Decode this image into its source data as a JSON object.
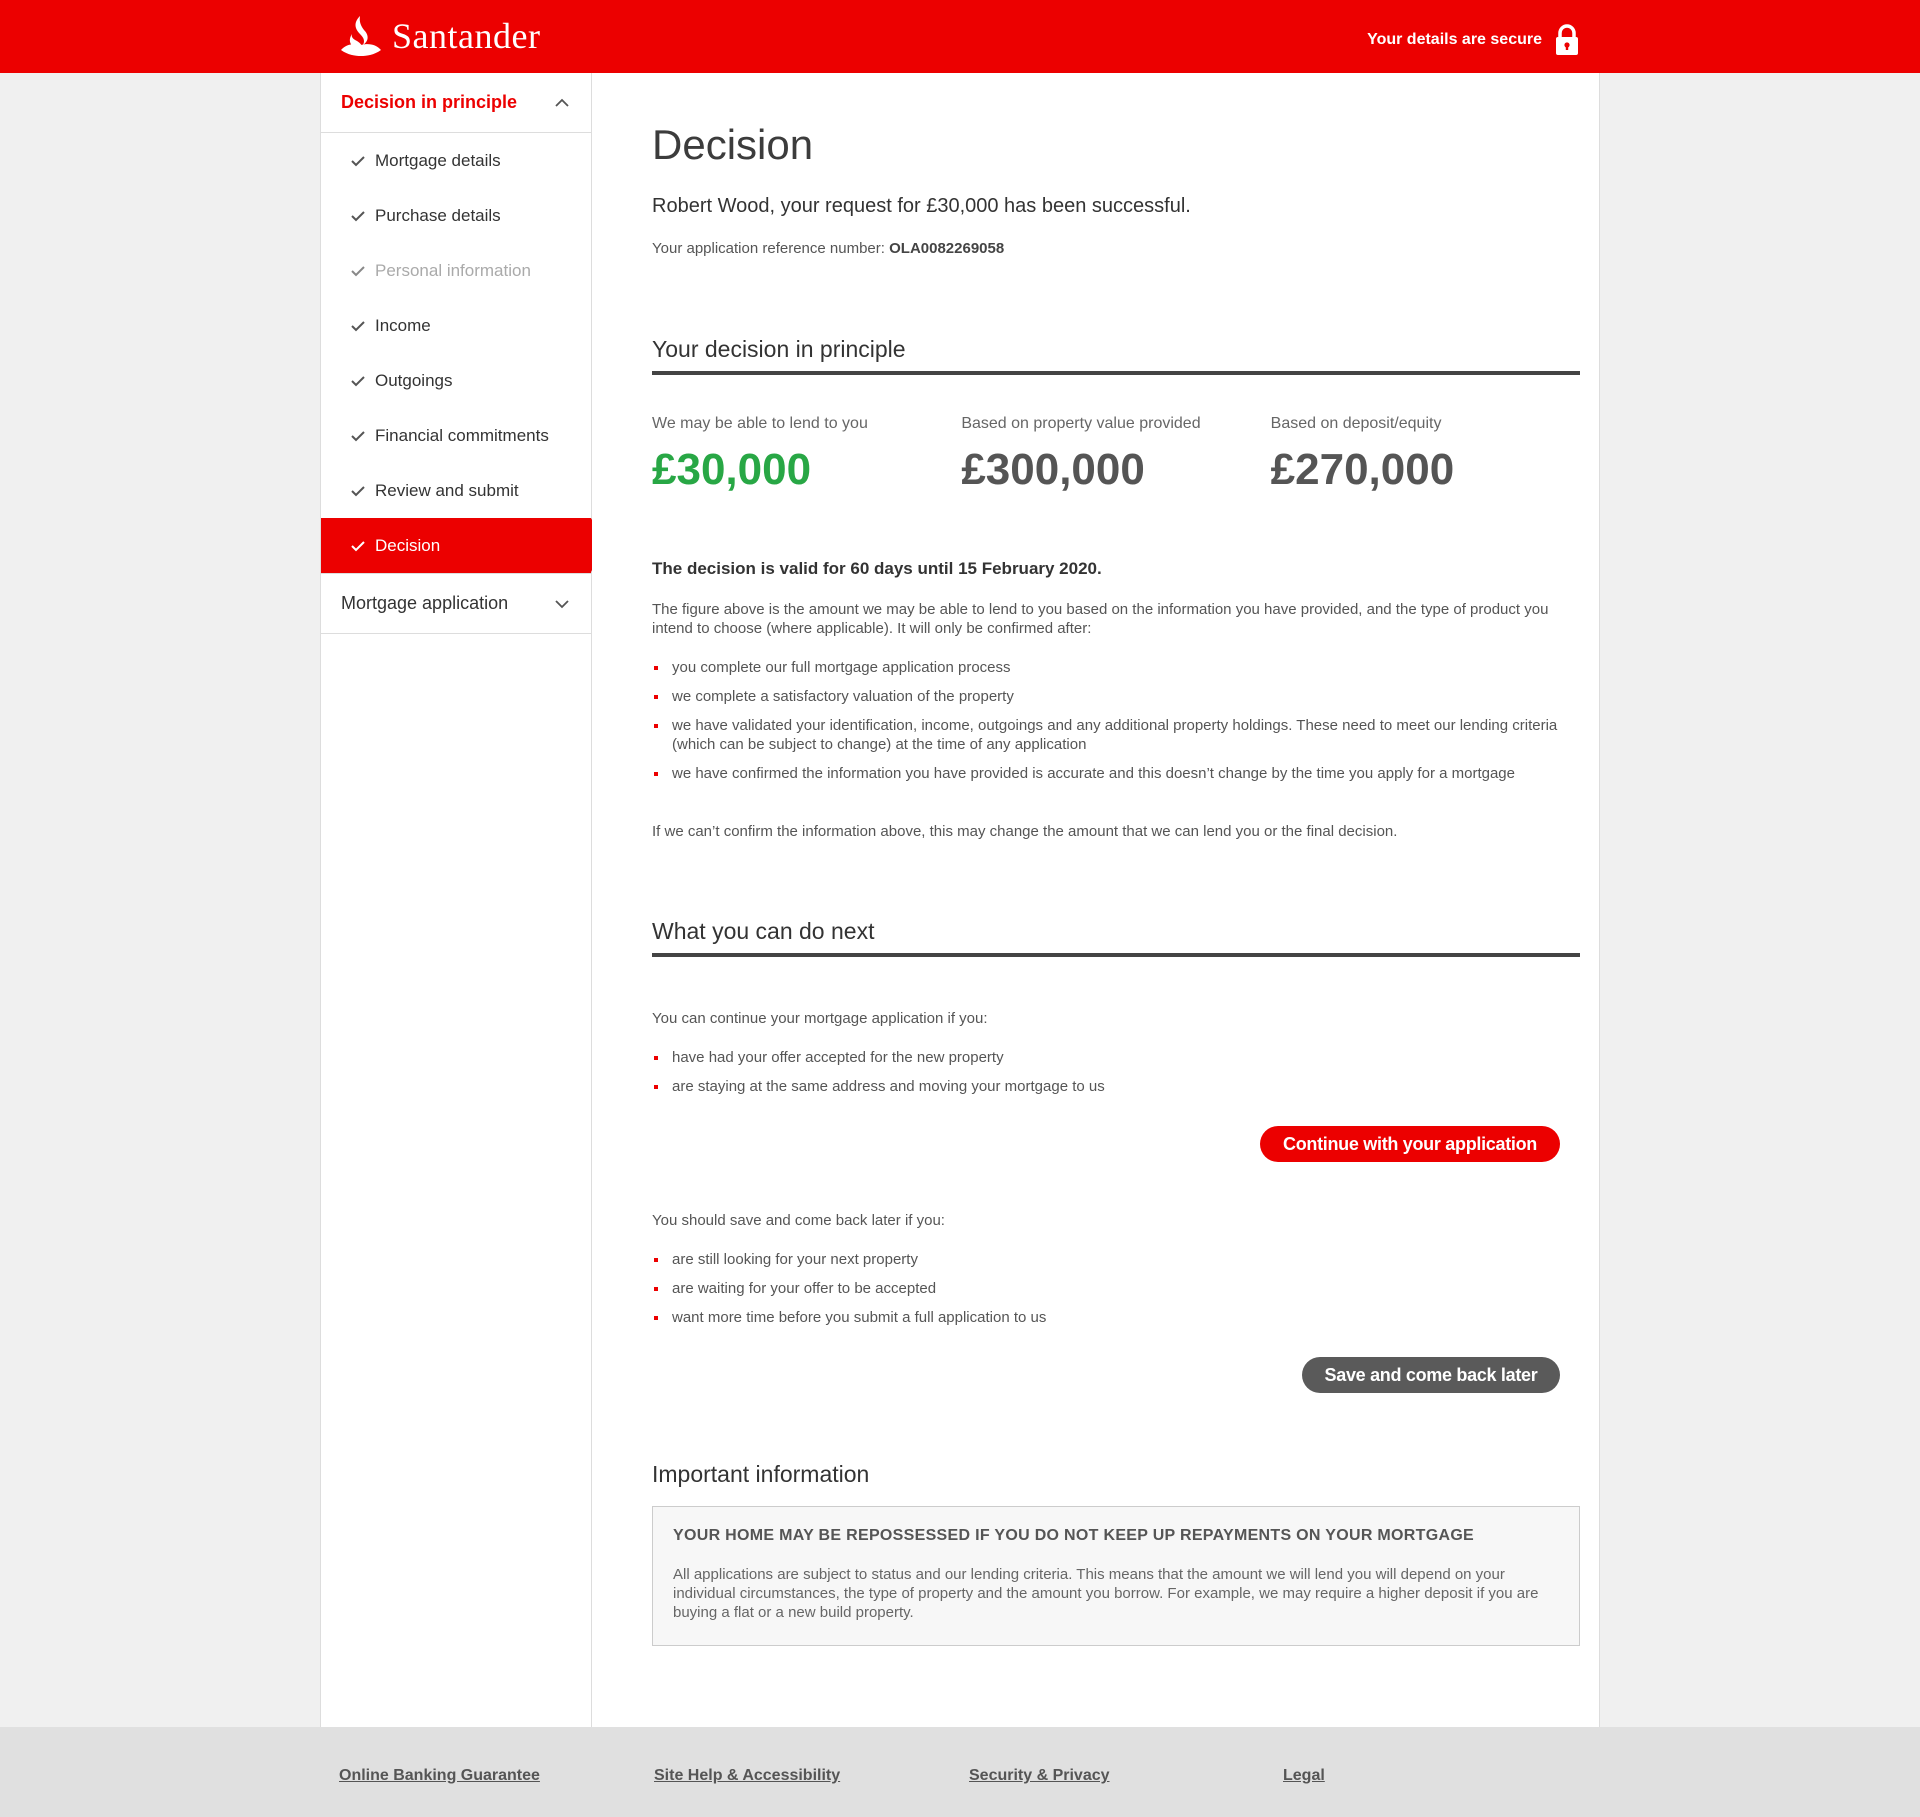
{
  "header": {
    "brand": "Santander",
    "secure_text": "Your details are secure"
  },
  "sidebar": {
    "section_title": "Decision in principle",
    "items": [
      {
        "label": "Mortgage details",
        "state": "done"
      },
      {
        "label": "Purchase details",
        "state": "done"
      },
      {
        "label": "Personal information",
        "state": "disabled"
      },
      {
        "label": "Income",
        "state": "done"
      },
      {
        "label": "Outgoings",
        "state": "done"
      },
      {
        "label": "Financial commitments",
        "state": "done"
      },
      {
        "label": "Review and submit",
        "state": "done"
      },
      {
        "label": "Decision",
        "state": "active"
      }
    ],
    "next_section": "Mortgage application"
  },
  "main": {
    "title": "Decision",
    "greeting": "Robert Wood, your request for £30,000 has been successful.",
    "ref_label": "Your application reference number:",
    "ref_number": "OLA0082269058",
    "dip_title": "Your decision in principle",
    "figures": [
      {
        "label": "We may be able to lend to you",
        "value": "£30,000",
        "color": "#28a745"
      },
      {
        "label": "Based on property value provided",
        "value": "£300,000"
      },
      {
        "label": "Based on deposit/equity",
        "value": "£270,000"
      }
    ],
    "valid_text": "The decision is valid for 60 days until 15 February 2020.",
    "figure_note": "The figure above is the amount we may be able to lend to you based on the information you have provided, and the type of product you intend to choose (where applicable). It will only be confirmed after:",
    "conditions": [
      "you complete our full mortgage application process",
      "we complete a satisfactory valuation of the property",
      "we have validated your identification, income, outgoings and any additional property holdings. These need to meet our lending criteria (which can be subject to change) at the time of any application",
      "we have confirmed the information you have provided is accurate and this doesn’t change by the time you apply for a mortgage"
    ],
    "cant_confirm": "If we can’t confirm the information above, this may change the amount that we can lend you or the final decision.",
    "next_title": "What you can do next",
    "continue_intro": "You can continue your mortgage application if you:",
    "continue_reasons": [
      "have had your offer accepted for the new property",
      "are staying at the same address and moving your mortgage to us"
    ],
    "continue_button": "Continue with your application",
    "save_intro": "You should save and come back later if you:",
    "save_reasons": [
      "are still looking for your next property",
      "are waiting for your offer to be accepted",
      "want more time before you submit a full application to us"
    ],
    "save_button": "Save and come back later",
    "important_title": "Important information",
    "warning_head": "YOUR HOME MAY BE REPOSSESSED IF YOU DO NOT KEEP UP REPAYMENTS ON YOUR MORTGAGE",
    "warning_text": "All applications are subject to status and our lending criteria. This means that the amount we will lend you will depend on your individual circumstances, the type of property and the amount you borrow. For example, we may require a higher deposit if you are buying a flat or a new build property."
  },
  "footer": {
    "links": [
      "Online Banking Guarantee",
      "Site Help & Accessibility",
      "Security & Privacy",
      "Legal"
    ]
  },
  "colors": {
    "brand_red": "#ec0000",
    "success_green": "#28a745"
  },
  "icons": [
    "santander-flame-icon",
    "lock-icon",
    "chevron-up-icon",
    "check-icon",
    "chevron-down-icon"
  ]
}
